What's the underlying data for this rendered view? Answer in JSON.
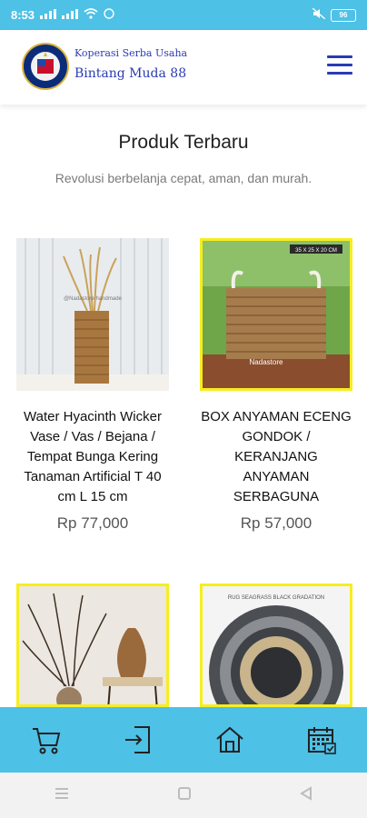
{
  "status_bar": {
    "time": "8:53",
    "battery": "96"
  },
  "header": {
    "brand_subtitle": "Koperasi Serba Usaha",
    "brand_name": "Bintang Muda 88"
  },
  "section": {
    "title": "Produk Terbaru",
    "subtitle": "Revolusi berbelanja cepat, aman, dan murah."
  },
  "products": [
    {
      "name": "Water Hyacinth Wicker Vase / Vas / Bejana / Tempat Bunga Kering Tanaman Artificial T 40 cm L 15 cm",
      "price": "Rp 77,000",
      "watermark": "@Nadastore handmade"
    },
    {
      "name": "BOX ANYAMAN ECENG GONDOK / KERANJANG ANYAMAN SERBAGUNA",
      "price": "Rp 57,000",
      "tag": "35 X 25 X 20 CM",
      "watermark": "Nadastore"
    },
    {
      "name": "",
      "price": ""
    },
    {
      "name": "",
      "price": "",
      "tag": "RUG SEAGRASS BLACK GRADATION"
    }
  ],
  "colors": {
    "accent": "#4ec1e6",
    "brand": "#2a3bb5",
    "highlight": "#f6ee1f"
  },
  "bottom_nav": [
    "cart-icon",
    "login-icon",
    "home-icon",
    "calendar-icon"
  ]
}
